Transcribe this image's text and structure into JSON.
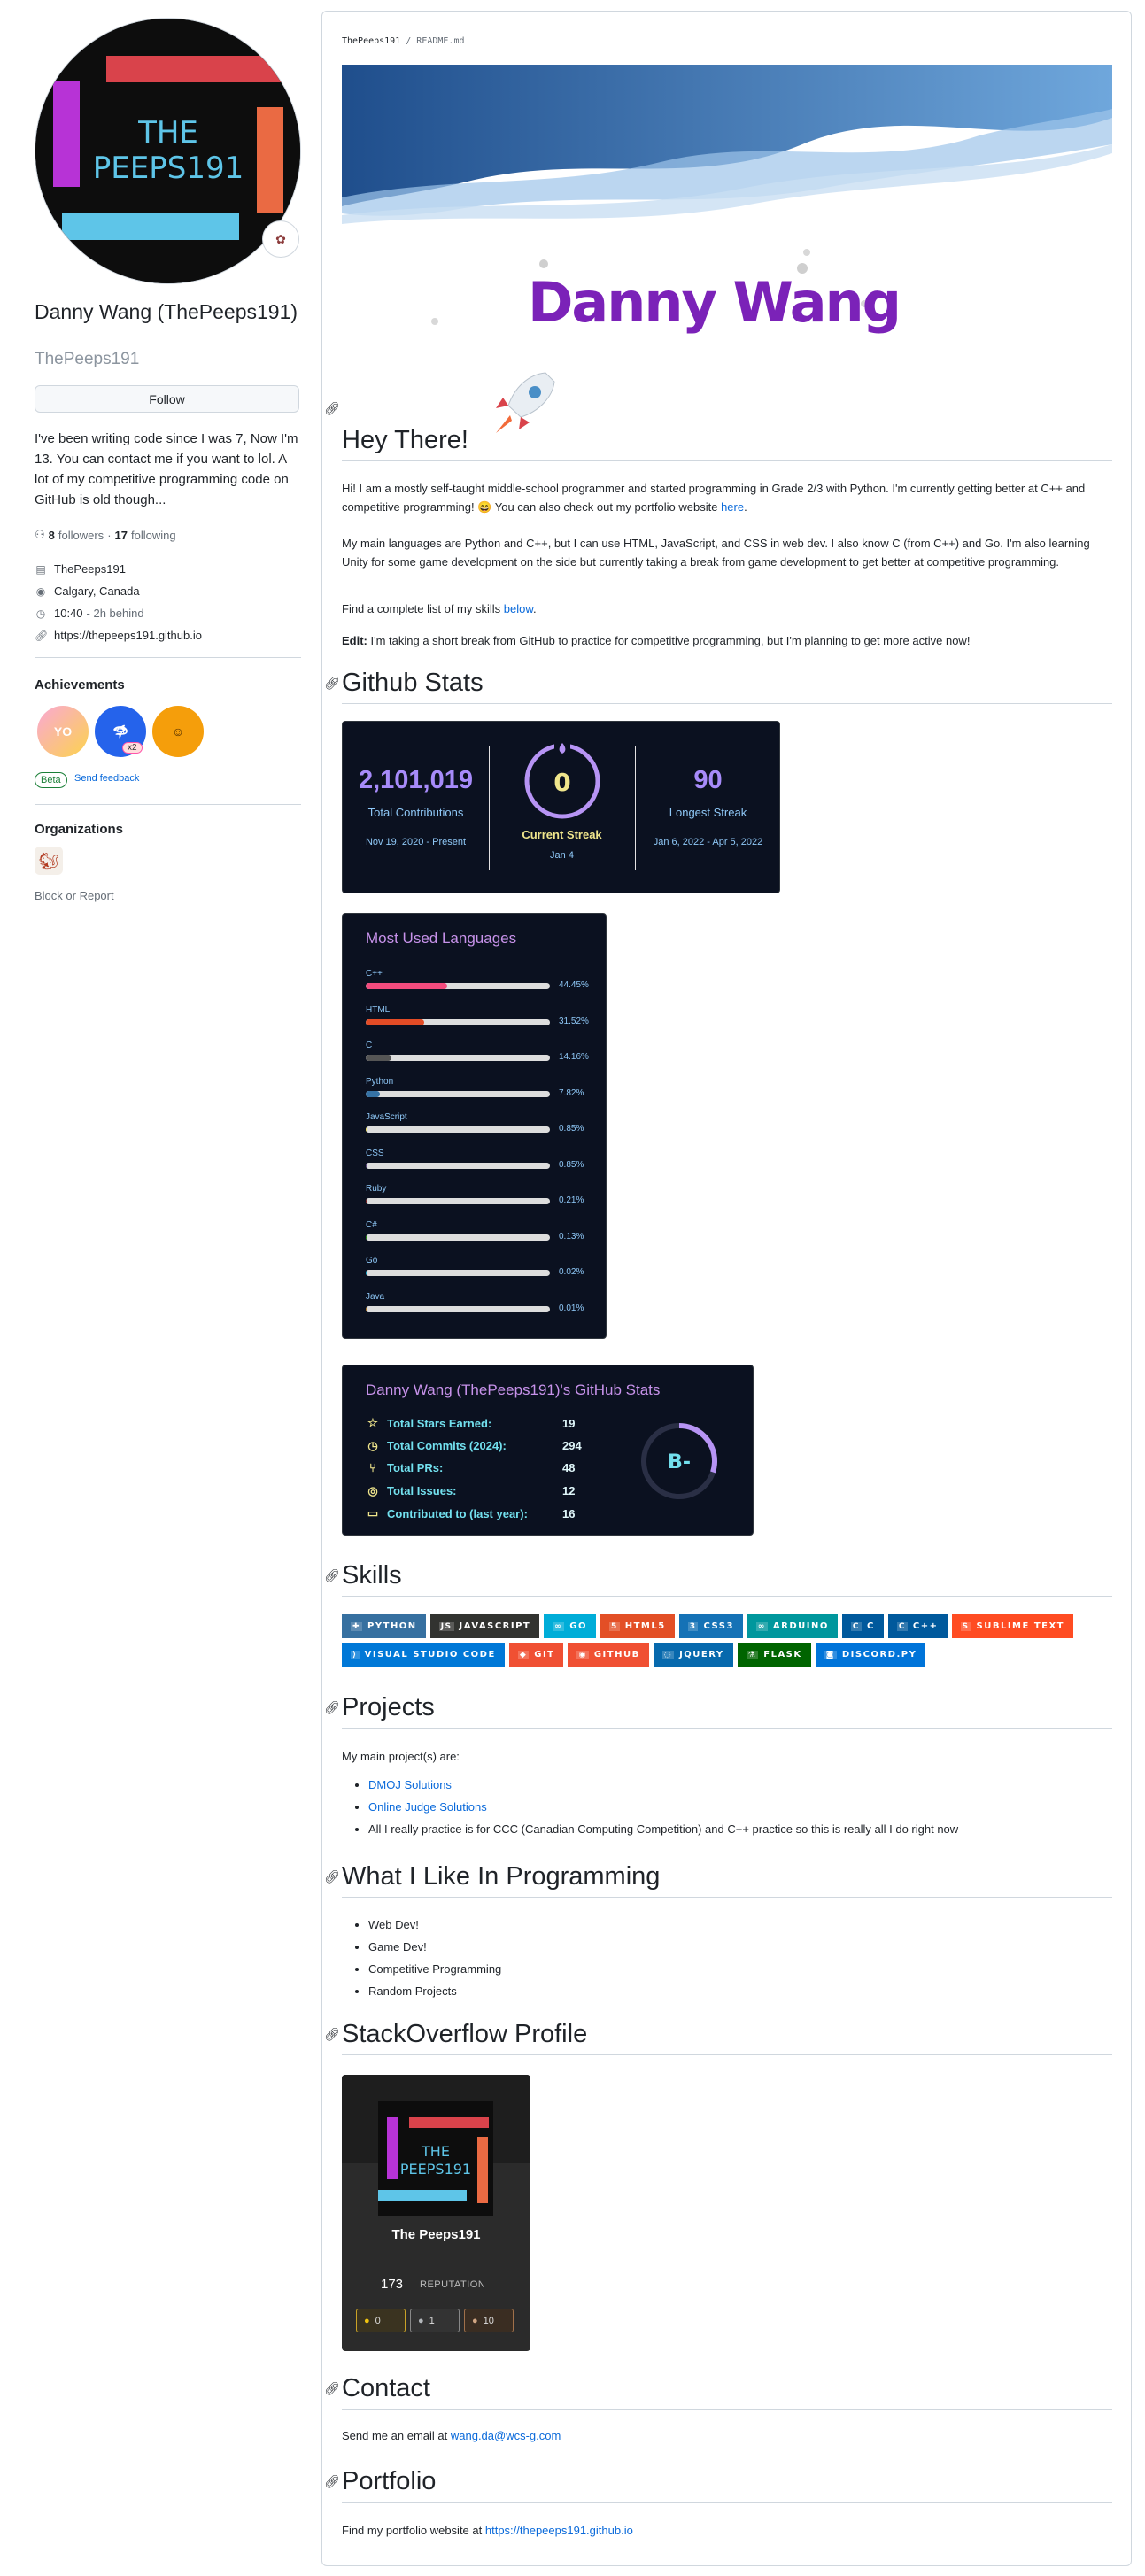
{
  "profile": {
    "name": "Danny Wang (ThePeeps191)",
    "login": "ThePeeps191",
    "follow_label": "Follow",
    "bio": "I've been writing code since I was 7, Now I'm 13. You can contact me if you want to lol. A lot of my competitive programming code on GitHub is old though...",
    "followers_count": "8",
    "followers_label": "followers",
    "following_count": "17",
    "following_label": "following",
    "separator": "·",
    "company": "ThePeeps191",
    "location": "Calgary, Canada",
    "local_time": "10:40",
    "time_behind": "- 2h behind",
    "website": "https://thepeeps191.github.io",
    "avatar_text": "THE PEEPS191",
    "achievements_heading": "Achievements",
    "achievement_badges": [
      "YOLO",
      "Shark",
      "Quickdraw"
    ],
    "achievement_multiplier": "x2",
    "beta_label": "Beta",
    "send_feedback": "Send feedback",
    "organizations_heading": "Organizations",
    "block_report": "Block or Report"
  },
  "readme": {
    "breadcrumb_user": "ThePeeps191",
    "breadcrumb_sep": " / ",
    "breadcrumb_file": "README.md",
    "banner_title": "Danny Wang",
    "hey_heading": "Hey There!",
    "intro_p1": "Hi! I am a mostly self-taught middle-school programmer and started programming in Grade 2/3 with Python. I'm currently getting better at C++ and competitive programming! 😄 You can also check out my portfolio website ",
    "intro_p1_link": "here",
    "intro_p2": "My main languages are Python and C++, but I can use HTML, JavaScript, and CSS in web dev. I also know C (from C++) and Go. I'm also learning Unity for some game development on the side but currently taking a break from game development to get better at competitive programming.",
    "intro_p3": "Find a complete list of my skills ",
    "intro_p3_link": "below",
    "intro_edit_label": "Edit:",
    "intro_edit": " I'm taking a short break from GitHub to practice for competitive programming, but I'm planning to get more active now!",
    "stats_heading": "Github Stats",
    "streak": {
      "total": "2,101,019",
      "total_label": "Total Contributions",
      "total_range": "Nov 19, 2020 - Present",
      "current": "0",
      "current_label": "Current Streak",
      "current_date": "Jan 4",
      "longest": "90",
      "longest_label": "Longest Streak",
      "longest_range": "Jan 6, 2022 - Apr 5, 2022"
    },
    "languages_title": "Most Used Languages",
    "languages": [
      {
        "name": "C++",
        "pct": "44.45%",
        "value": 44.45,
        "color": "#f34b7d"
      },
      {
        "name": "HTML",
        "pct": "31.52%",
        "value": 31.52,
        "color": "#e34c26"
      },
      {
        "name": "C",
        "pct": "14.16%",
        "value": 14.16,
        "color": "#555555"
      },
      {
        "name": "Python",
        "pct": "7.82%",
        "value": 7.82,
        "color": "#3572A5"
      },
      {
        "name": "JavaScript",
        "pct": "0.85%",
        "value": 0.85,
        "color": "#f1e05a"
      },
      {
        "name": "CSS",
        "pct": "0.85%",
        "value": 0.85,
        "color": "#563d7c"
      },
      {
        "name": "Ruby",
        "pct": "0.21%",
        "value": 0.21,
        "color": "#701516"
      },
      {
        "name": "C#",
        "pct": "0.13%",
        "value": 0.13,
        "color": "#178600"
      },
      {
        "name": "Go",
        "pct": "0.02%",
        "value": 0.02,
        "color": "#00ADD8"
      },
      {
        "name": "Java",
        "pct": "0.01%",
        "value": 0.01,
        "color": "#b07219"
      }
    ],
    "gh_title": "Danny Wang (ThePeeps191)'s GitHub Stats",
    "gh_rows": [
      {
        "label": "Total Stars Earned:",
        "value": "19",
        "icon": "star-icon"
      },
      {
        "label": "Total Commits (2024):",
        "value": "294",
        "icon": "history-icon"
      },
      {
        "label": "Total PRs:",
        "value": "48",
        "icon": "pull-request-icon"
      },
      {
        "label": "Total Issues:",
        "value": "12",
        "icon": "issue-icon"
      },
      {
        "label": "Contributed to (last year):",
        "value": "16",
        "icon": "repo-icon"
      }
    ],
    "gh_rank": "B-",
    "gh_rank_progress": 0.3,
    "skills_heading": "Skills",
    "skills": [
      {
        "label": "PYTHON",
        "color": "#3670A0",
        "icon": "python-icon"
      },
      {
        "label": "JAVASCRIPT",
        "color": "#323330",
        "icon": "javascript-icon"
      },
      {
        "label": "GO",
        "color": "#00ADD8",
        "icon": "go-icon"
      },
      {
        "label": "HTML5",
        "color": "#E34F26",
        "icon": "html5-icon"
      },
      {
        "label": "CSS3",
        "color": "#1572B6",
        "icon": "css3-icon"
      },
      {
        "label": "ARDUINO",
        "color": "#00979D",
        "icon": "arduino-icon"
      },
      {
        "label": "C",
        "color": "#00599C",
        "icon": "c-icon"
      },
      {
        "label": "C++",
        "color": "#00599C",
        "icon": "cpp-icon"
      },
      {
        "label": "SUBLIME TEXT",
        "color": "#FF4C22",
        "icon": "sublime-icon"
      },
      {
        "label": "VISUAL STUDIO CODE",
        "color": "#0078d7",
        "icon": "vscode-icon"
      },
      {
        "label": "GIT",
        "color": "#F05033",
        "icon": "git-icon"
      },
      {
        "label": "GITHUB",
        "color": "#F05033",
        "icon": "github-icon"
      },
      {
        "label": "JQUERY",
        "color": "#0769AD",
        "icon": "jquery-icon"
      },
      {
        "label": "FLASK",
        "color": "#006400",
        "icon": "flask-icon"
      },
      {
        "label": "DISCORD.PY",
        "color": "#0074D9",
        "icon": "discord-icon"
      }
    ],
    "projects_heading": "Projects",
    "projects_intro": "My main project(s) are:",
    "projects": [
      {
        "text": "DMOJ Solutions",
        "link": true
      },
      {
        "text": "Online Judge Solutions",
        "link": true
      },
      {
        "text": "All I really practice is for CCC (Canadian Computing Competition) and C++ practice so this is really all I do right now",
        "link": false
      }
    ],
    "like_heading": "What I Like In Programming",
    "likes": [
      "Web Dev!",
      "Game Dev!",
      "Competitive Programming",
      "Random Projects"
    ],
    "so_heading": "StackOverflow Profile",
    "so_name": "The Peeps191",
    "so_rep": "173",
    "so_rep_label": "REPUTATION",
    "so_gold": "0",
    "so_silver": "1",
    "so_bronze": "10",
    "contact_heading": "Contact",
    "contact_text": "Send me an email at ",
    "contact_email": "wang.da@wcs-g.com",
    "portfolio_heading": "Portfolio",
    "portfolio_text": "Find my portfolio website at ",
    "portfolio_link": "https://thepeeps191.github.io"
  }
}
